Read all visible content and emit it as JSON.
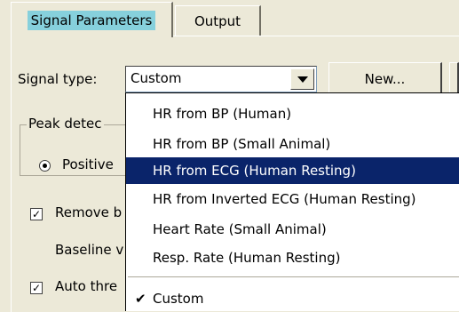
{
  "tabs": [
    {
      "label": "Signal Parameters",
      "active": true
    },
    {
      "label": "Output",
      "active": false
    }
  ],
  "signal_type": {
    "label": "Signal type:",
    "value": "Custom",
    "new_button": "New..."
  },
  "peak_detection": {
    "legend": "Peak detec",
    "radio_label": "Positive"
  },
  "remove_checkbox": {
    "label": "Remove b",
    "checked": true
  },
  "baseline_label": "Baseline v",
  "auto_threshold_checkbox": {
    "label": "Auto thre",
    "checked": true
  },
  "dropdown": {
    "items": [
      {
        "label": "HR from BP (Human)",
        "selected": false
      },
      {
        "label": "HR from BP (Small Animal)",
        "selected": false
      },
      {
        "label": "HR from ECG (Human Resting)",
        "selected": true
      },
      {
        "label": "HR from Inverted ECG (Human Resting)",
        "selected": false
      },
      {
        "label": "Heart Rate (Small Animal)",
        "selected": false
      },
      {
        "label": "Resp. Rate (Human Resting)",
        "selected": false
      }
    ],
    "checked_item": {
      "label": "Custom",
      "mark": "✔"
    }
  },
  "colors": {
    "selection": "#0a246a",
    "active_tab_highlight": "#86d0dc",
    "face": "#ece9d8"
  }
}
